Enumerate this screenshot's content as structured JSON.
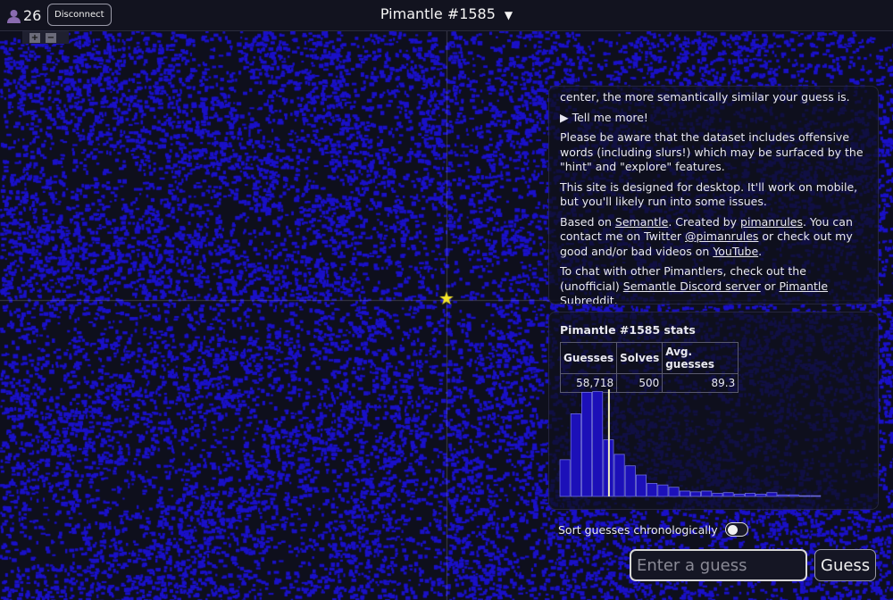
{
  "header": {
    "player_count": "26",
    "disconnect_label": "Disconnect",
    "title": "Pimantle #1585",
    "title_caret": "▼"
  },
  "map": {
    "zoom_in_label": "+",
    "zoom_out_label": "−",
    "target_marker": "★",
    "colors": {
      "dots": "#1a10c8",
      "background": "#0e0f1c",
      "star": "#f5e62a"
    }
  },
  "about": {
    "p0": "center, the more semantically similar your guess is.",
    "tell_more": "▶ Tell me more!",
    "p1": "Please be aware that the dataset includes offensive words (including slurs!) which may be surfaced by the \"hint\" and \"explore\" features.",
    "p2": "This site is designed for desktop. It'll work on mobile, but you'll likely run into some issues.",
    "p3a": "Based on ",
    "p3_link1": "Semantle",
    "p3b": ". Created by ",
    "p3_link2": "pimanrules",
    "p3c": ". You can contact me on Twitter ",
    "p3_link3": "@pimanrules",
    "p3d": " or check out my good and/or bad videos on ",
    "p3_link4": "YouTube",
    "p3e": ".",
    "p4a": "To chat with other Pimantlers, check out the (unofficial) ",
    "p4_link1": "Semantle Discord server",
    "p4b": " or ",
    "p4_link2": "Pimantle Subreddit",
    "p4c": "."
  },
  "stats": {
    "title": "Pimantle #1585 stats",
    "headers": [
      "Guesses",
      "Solves",
      "Avg. guesses"
    ],
    "values": [
      "58,718",
      "500",
      "89.3"
    ]
  },
  "chart_data": {
    "type": "bar",
    "values": [
      48,
      108,
      136,
      137,
      74,
      55,
      40,
      28,
      17,
      15,
      12,
      7,
      6,
      7,
      4,
      5,
      3,
      4,
      3,
      5,
      2,
      2,
      1,
      1
    ],
    "marker_bin": 4.5,
    "colors": {
      "bar_fill": "#1c10b8",
      "bar_stroke": "#6e6ee0",
      "marker": "#f2eec0"
    }
  },
  "sort": {
    "label": "Sort guesses chronologically",
    "checked": false
  },
  "guess": {
    "placeholder": "Enter a guess",
    "button_label": "Guess"
  }
}
